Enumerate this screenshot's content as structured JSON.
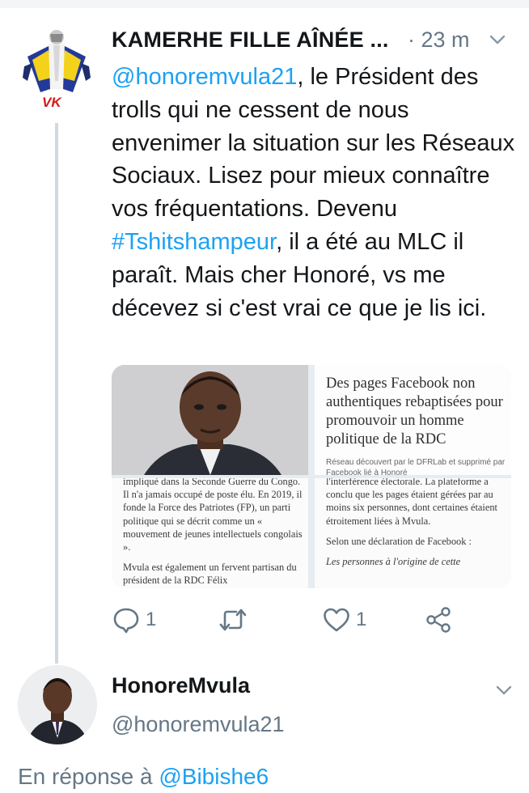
{
  "tweet": {
    "author_name": "KAMERHE FILLE AÎNÉE ...",
    "time": "· 23 m",
    "avatar_text": "VK",
    "body": {
      "mention": "@honoremvula21",
      "text_1": ", le Président des trolls qui ne cessent de nous envenimer la situation sur les Réseaux Sociaux. Lisez pour mieux connaître vos fréquentations. Devenu ",
      "hashtag": "#Tshitshampeur",
      "text_2": ", il a été au MLC il paraît. Mais cher Honoré, vs me décevez si c'est vrai ce que je lis ici."
    },
    "media": {
      "article_headline": "Des pages Facebook non authentiques rebaptisées pour promouvoir un homme politique de la RDC",
      "article_sub": "Réseau découvert par le DFRLab et supprimé par Facebook lié à Honoré",
      "left_text": [
        "impliqué dans la Seconde Guerre du Congo. Il n'a jamais occupé de poste élu. En 2019, il fonde la Force des Patriotes (FP), un parti politique qui se décrit comme un « mouvement de jeunes intellectuels congolais ».",
        "Mvula est également un fervent partisan du président de la RDC Félix"
      ],
      "right_text": [
        "l'interférence électorale. La plateforme a conclu que les pages étaient gérées par au moins six personnes, dont certaines étaient étroitement liées à Mvula.",
        "Selon une déclaration de Facebook :"
      ],
      "right_lead": "Les personnes à l'origine de cette"
    },
    "actions": {
      "reply_count": "1",
      "retweet_count": "",
      "like_count": "1"
    }
  },
  "reply": {
    "name": "HonoreMvula",
    "handle": "@honoremvula21",
    "in_reply_prefix": "En réponse à ",
    "in_reply_to": "@Bibishe6"
  },
  "icons": [
    "chevron-down-icon",
    "reply-icon",
    "retweet-icon",
    "like-icon",
    "share-icon"
  ],
  "colors": {
    "link": "#1da1f2",
    "muted": "#657786",
    "text": "#14171a"
  }
}
